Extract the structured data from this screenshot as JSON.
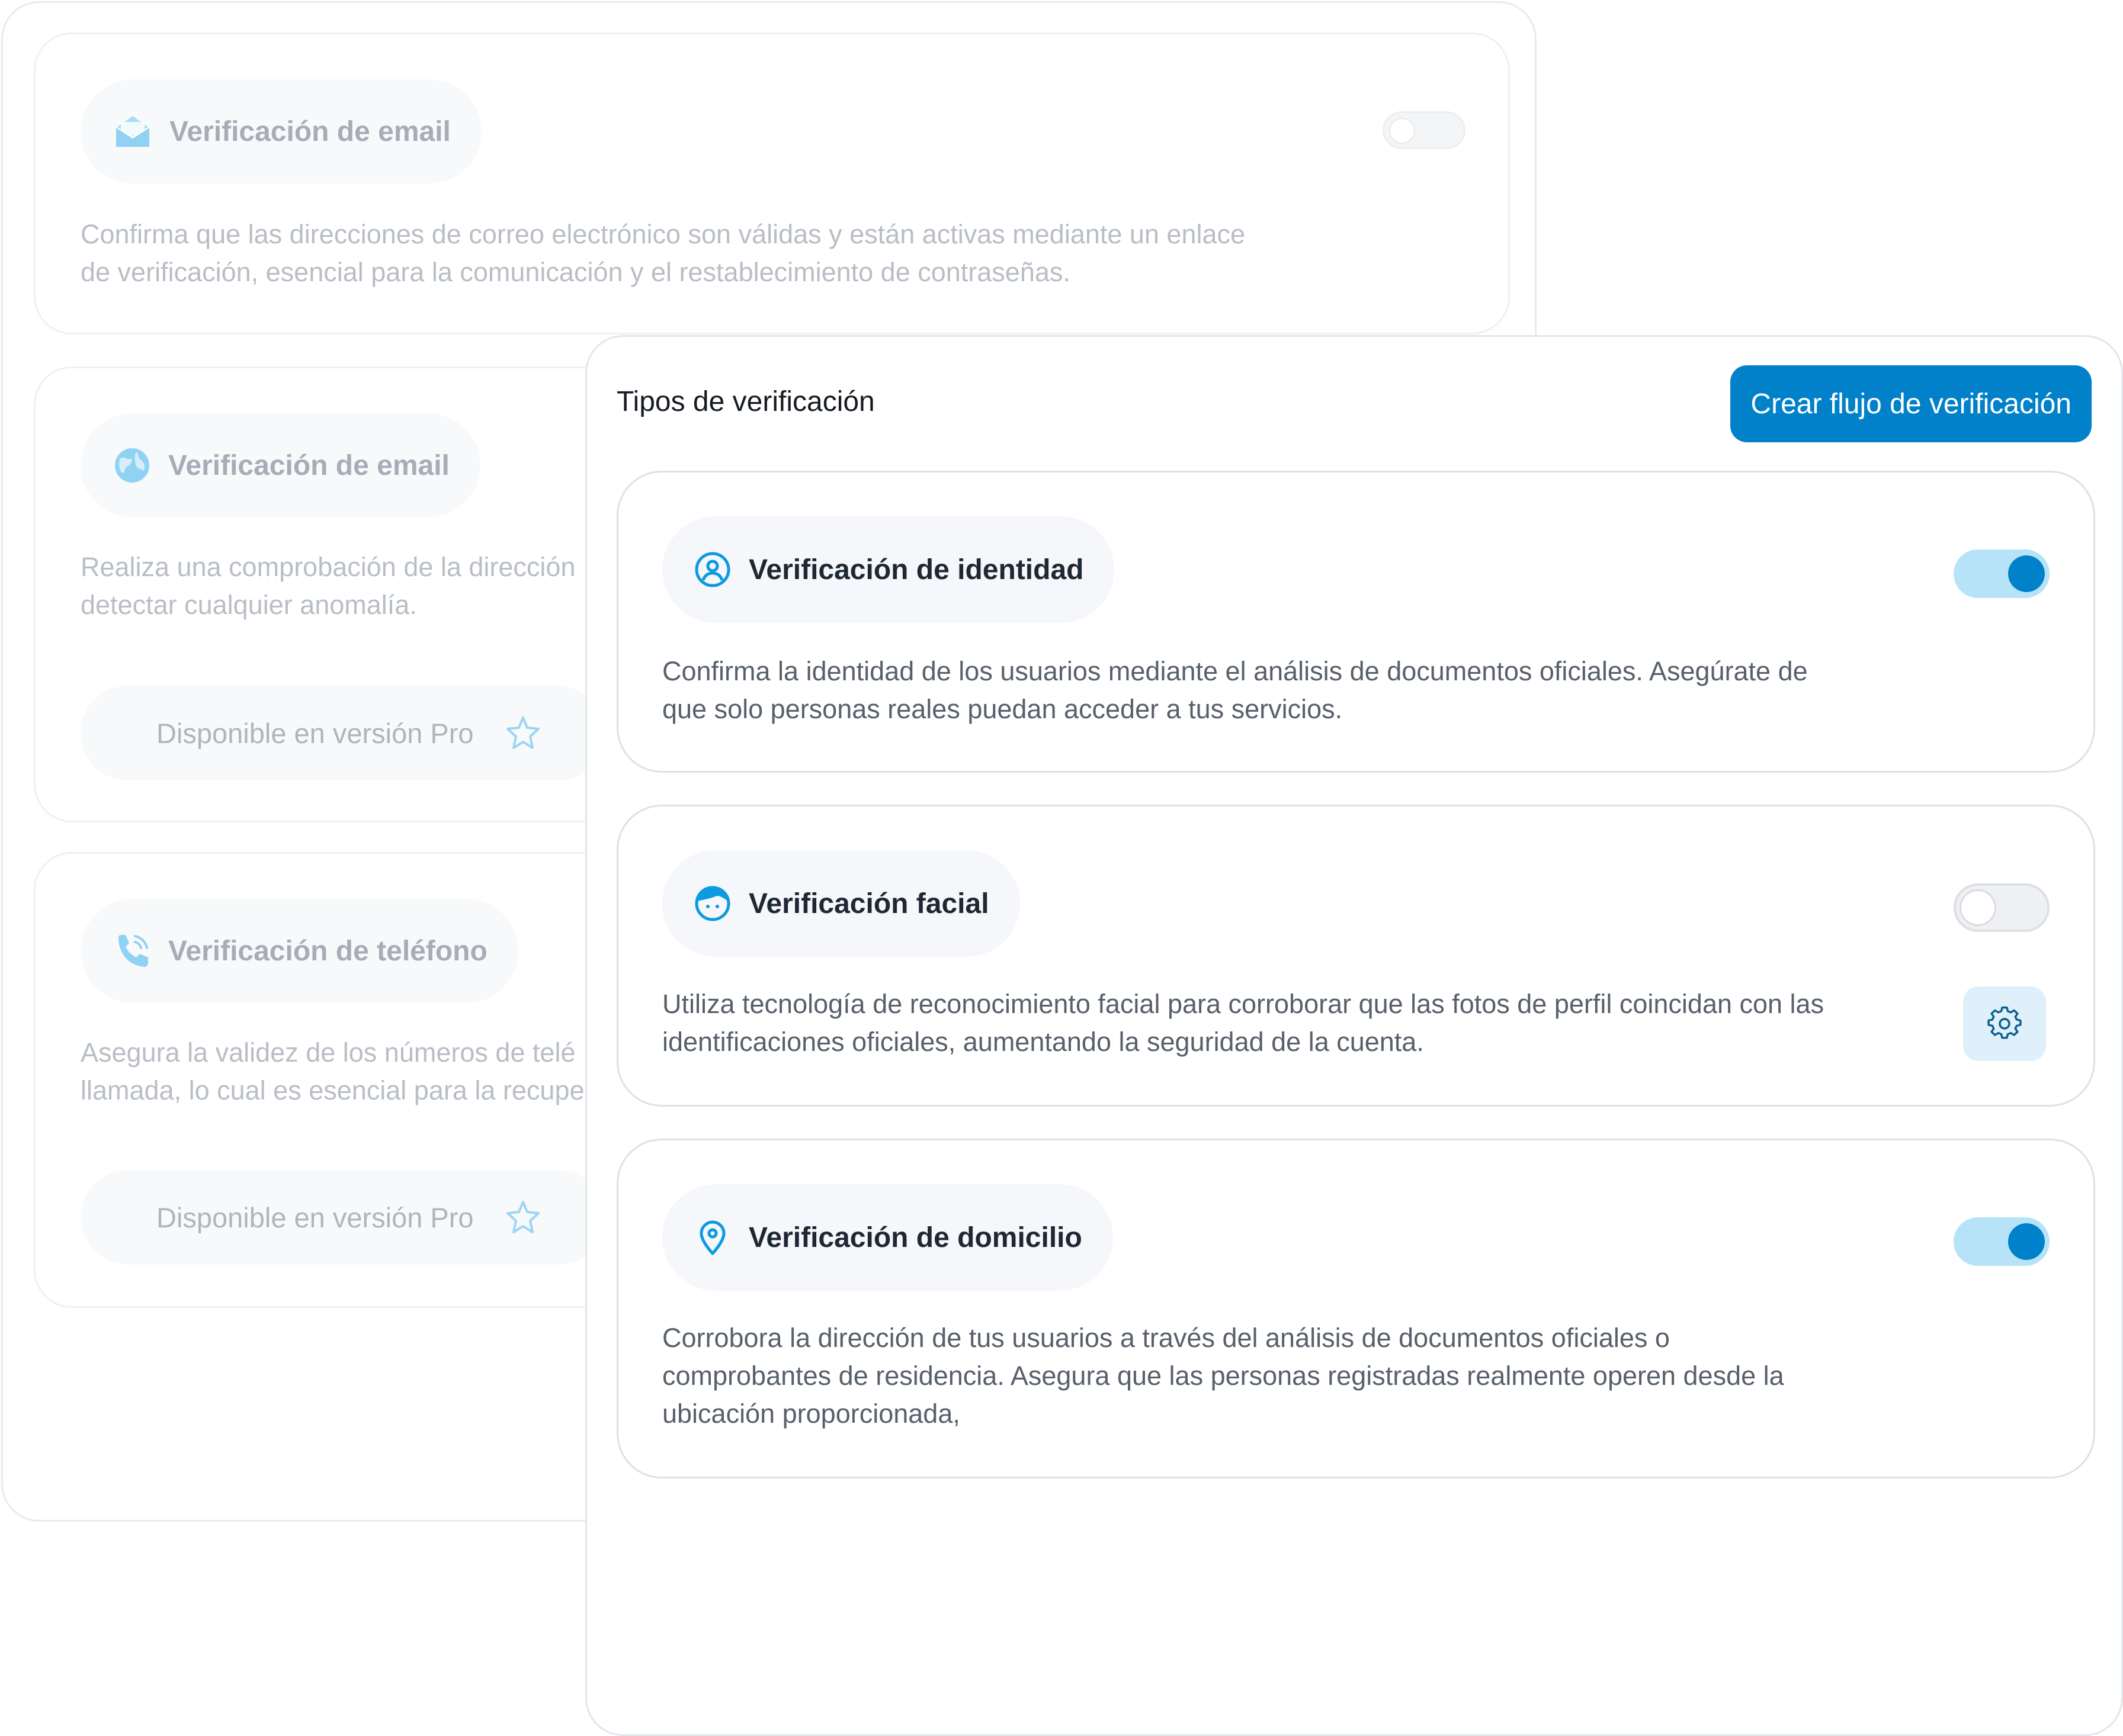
{
  "background_panel": {
    "cards": [
      {
        "icon": "envelope-icon",
        "title": "Verificación de email",
        "description_lines": [
          "Confirma que las direcciones de correo electrónico son válidas y están activas mediante un enlace",
          "de verificación, esencial para la comunicación y el restablecimiento de contraseñas."
        ],
        "toggle_state": "off"
      },
      {
        "icon": "globe-icon",
        "title": "Verificación de email",
        "description_lines": [
          "Realiza una comprobación de la dirección",
          "detectar cualquier anomalía."
        ],
        "pro_label": "Disponible en versión Pro"
      },
      {
        "icon": "phone-icon",
        "title": "Verificación de teléfono",
        "description_lines": [
          "Asegura la validez de los números de telé",
          "llamada, lo cual es esencial para la recupe"
        ],
        "pro_label": "Disponible en versión Pro"
      }
    ]
  },
  "main_panel": {
    "header": {
      "title": "Tipos de verificación",
      "cta_label": "Crear flujo de verificación"
    },
    "cards": [
      {
        "icon": "user-circle-icon",
        "title": "Verificación de identidad",
        "description_lines": [
          "Confirma la identidad de los usuarios mediante el análisis de documentos oficiales. Asegúrate de",
          "que solo personas reales puedan acceder a tus servicios."
        ],
        "toggle_state": "on"
      },
      {
        "icon": "face-icon",
        "title": "Verificación facial",
        "description_lines": [
          "Utiliza tecnología de reconocimiento facial para corroborar que las fotos de perfil coincidan con las",
          "identificaciones oficiales, aumentando la seguridad de la cuenta."
        ],
        "toggle_state": "off",
        "settings_icon": "gear-icon"
      },
      {
        "icon": "map-pin-icon",
        "title": "Verificación de domicilio",
        "description_lines": [
          "Corrobora la dirección de tus usuarios a través del análisis de documentos oficiales o",
          "comprobantes de residencia. Asegura que las personas registradas realmente operen desde la",
          "ubicación proporcionada,"
        ],
        "toggle_state": "on"
      }
    ]
  },
  "colors": {
    "accent": "#0081c9",
    "accent_light": "#b7e3f8",
    "icon_blue": "#0a9be0"
  }
}
